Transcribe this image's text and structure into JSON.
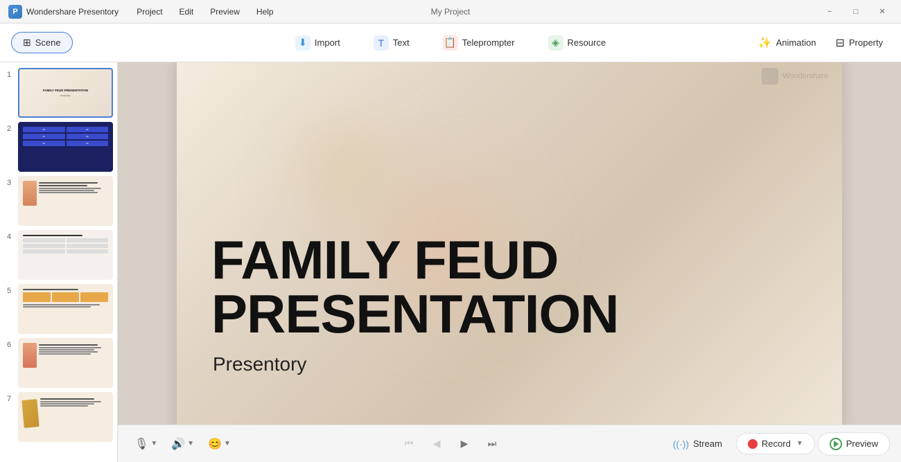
{
  "app": {
    "name": "Wondershare Presentory",
    "project_name": "My Project"
  },
  "titlebar": {
    "menu_items": [
      "Project",
      "Edit",
      "Preview",
      "Help"
    ],
    "controls": [
      "minimize",
      "maximize",
      "close"
    ]
  },
  "toolbar": {
    "scene_label": "Scene",
    "items": [
      {
        "id": "import",
        "label": "Import",
        "icon": "import-icon"
      },
      {
        "id": "text",
        "label": "Text",
        "icon": "text-icon"
      },
      {
        "id": "teleprompter",
        "label": "Teleprompter",
        "icon": "teleprompter-icon"
      },
      {
        "id": "resource",
        "label": "Resource",
        "icon": "resource-icon"
      }
    ],
    "right_items": [
      {
        "id": "animation",
        "label": "Animation"
      },
      {
        "id": "property",
        "label": "Property"
      }
    ]
  },
  "slides": [
    {
      "number": "1",
      "active": true,
      "title": "FAMILY FEUD PRESENTATION",
      "subtitle": "Presentory"
    },
    {
      "number": "2",
      "active": false
    },
    {
      "number": "3",
      "active": false
    },
    {
      "number": "4",
      "active": false
    },
    {
      "number": "5",
      "active": false
    },
    {
      "number": "6",
      "active": false
    },
    {
      "number": "7",
      "active": false
    }
  ],
  "canvas": {
    "title": "FAMILY FEUD PRESENTATION",
    "subtitle": "Presentory",
    "watermark": "Wondershare"
  },
  "bottom_bar": {
    "tools": [
      {
        "id": "mic",
        "icon": "🎙",
        "has_caret": true
      },
      {
        "id": "speaker",
        "icon": "🔊",
        "has_caret": true
      },
      {
        "id": "face",
        "icon": "😊",
        "has_caret": true
      }
    ],
    "nav": [
      {
        "id": "prev-scene",
        "icon": "⏮",
        "disabled": true
      },
      {
        "id": "prev",
        "icon": "◀",
        "disabled": true
      },
      {
        "id": "next",
        "icon": "▶",
        "disabled": false
      },
      {
        "id": "next-scene",
        "icon": "⏭",
        "disabled": false
      }
    ],
    "actions": [
      {
        "id": "stream",
        "label": "Stream"
      },
      {
        "id": "record",
        "label": "Record"
      },
      {
        "id": "preview",
        "label": "Preview"
      }
    ]
  }
}
